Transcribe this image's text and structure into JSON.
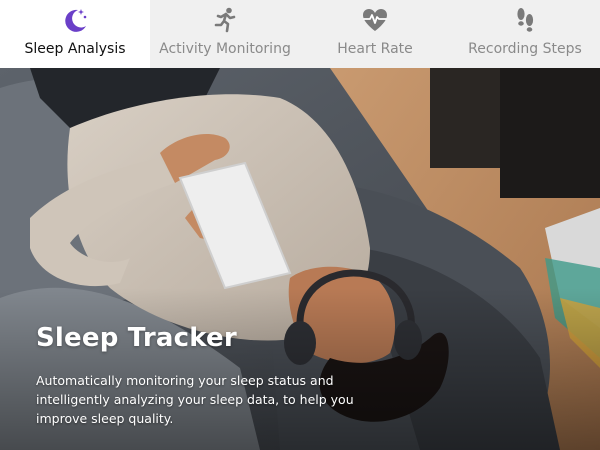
{
  "tabs": [
    {
      "label": "Sleep Analysis",
      "icon": "moon-stars-icon",
      "active": true
    },
    {
      "label": "Activity Monitoring",
      "icon": "running-person-icon",
      "active": false
    },
    {
      "label": "Heart Rate",
      "icon": "heart-pulse-icon",
      "active": false
    },
    {
      "label": "Recording Steps",
      "icon": "footprints-icon",
      "active": false
    }
  ],
  "hero": {
    "title": "Sleep Tracker",
    "description": "Automatically monitoring your sleep status and intelligently analyzing your sleep data, to help you improve sleep quality.",
    "image_subject": "person-sleeping-with-headphones-and-tablet"
  },
  "colors": {
    "accent": "#6a3fc8",
    "icon_gray": "#7a7a7a",
    "tab_bar_bg": "#f0f0f0",
    "active_tab_bg": "#ffffff"
  }
}
